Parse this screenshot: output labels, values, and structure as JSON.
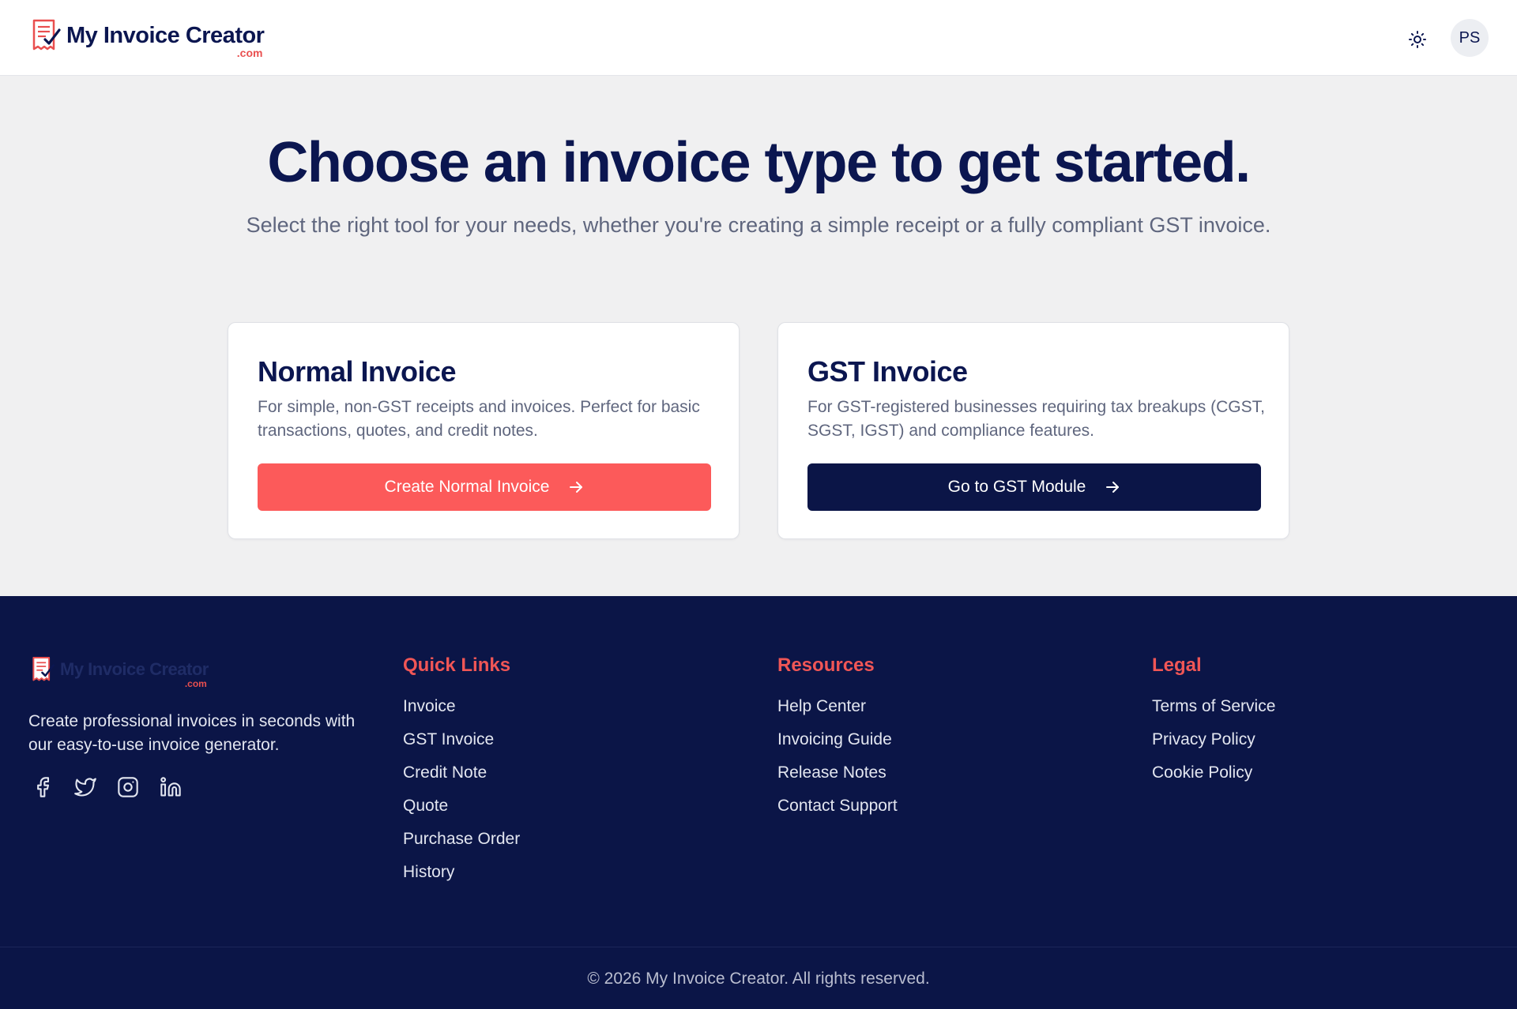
{
  "header": {
    "logo_name": "My Invoice Creator",
    "logo_suffix": ".com",
    "theme_icon": "sun-icon",
    "avatar_initials": "PS"
  },
  "hero": {
    "title": "Choose an invoice type to get started.",
    "subtitle": "Select the right tool for your needs, whether you're creating a simple receipt or a fully compliant GST invoice."
  },
  "cards": [
    {
      "title": "Normal Invoice",
      "description": "For simple, non-GST receipts and invoices. Perfect for basic transactions, quotes, and credit notes.",
      "button_label": "Create Normal Invoice",
      "button_color": "#fc5a5a"
    },
    {
      "title": "GST Invoice",
      "description": "For GST-registered businesses requiring tax breakups (CGST, SGST, IGST) and compliance features.",
      "button_label": "Go to GST Module",
      "button_color": "#0b1547"
    }
  ],
  "footer": {
    "logo_name": "My Invoice Creator",
    "logo_suffix": ".com",
    "tagline": "Create professional invoices in seconds with our easy-to-use invoice generator.",
    "socials": [
      "facebook-icon",
      "twitter-icon",
      "instagram-icon",
      "linkedin-icon"
    ],
    "quick_links": {
      "title": "Quick Links",
      "items": [
        "Invoice",
        "GST Invoice",
        "Credit Note",
        "Quote",
        "Purchase Order",
        "History"
      ]
    },
    "resources": {
      "title": "Resources",
      "items": [
        "Help Center",
        "Invoicing Guide",
        "Release Notes",
        "Contact Support"
      ]
    },
    "legal": {
      "title": "Legal",
      "items": [
        "Terms of Service",
        "Privacy Policy",
        "Cookie Policy"
      ]
    },
    "copyright": "© 2026 My Invoice Creator. All rights reserved."
  },
  "colors": {
    "navy": "#0b1650",
    "footer_bg": "#0b1547",
    "accent_red": "#fc5a5a",
    "footer_heading": "#f05656"
  }
}
